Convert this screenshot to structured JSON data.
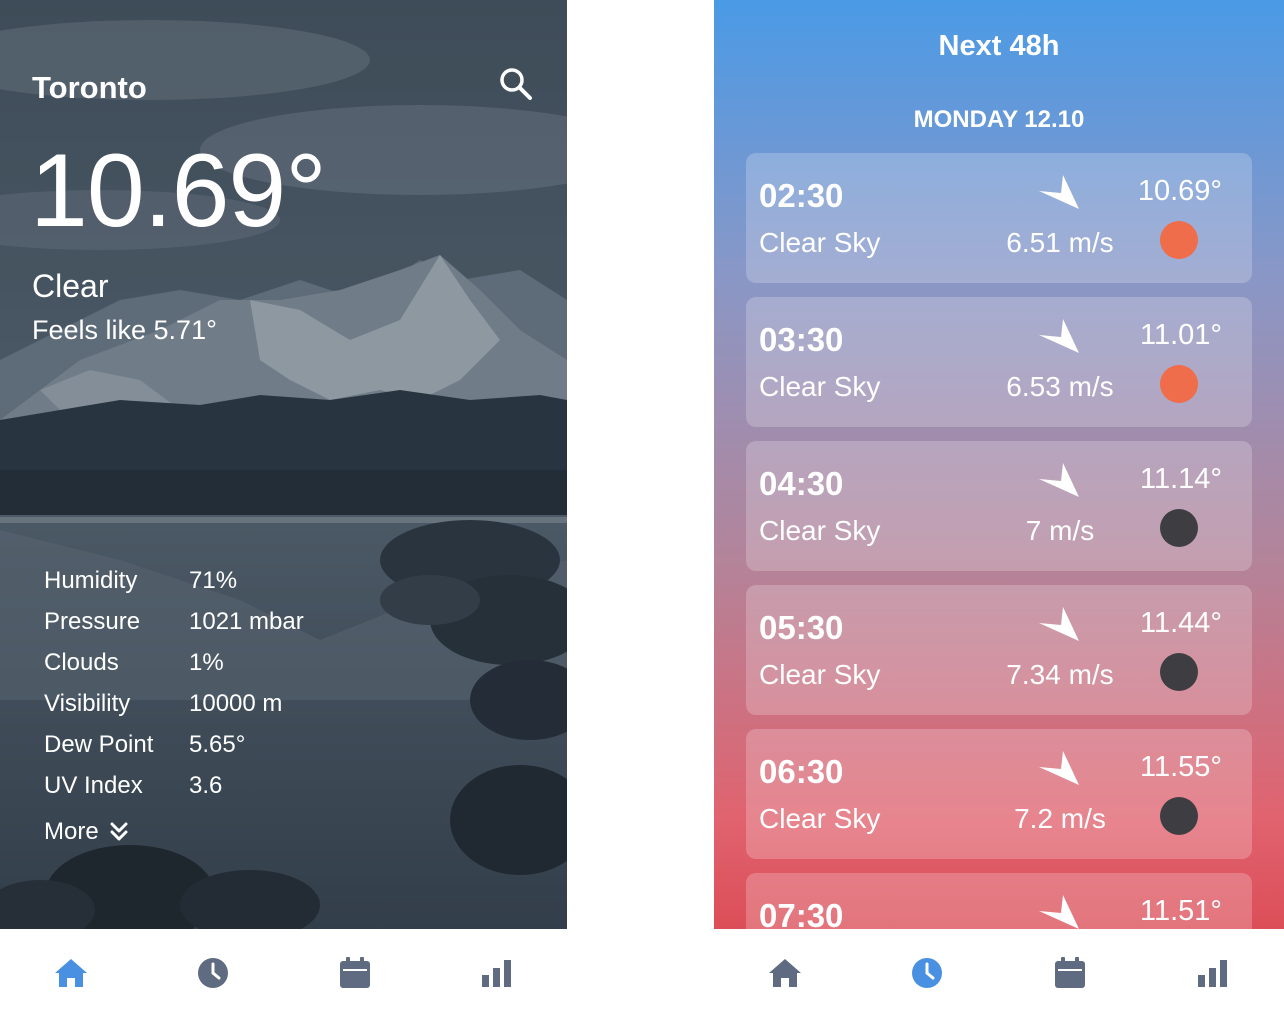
{
  "left": {
    "city": "Toronto",
    "temperature": "10.69°",
    "condition": "Clear",
    "feels_like": "Feels like 5.71°",
    "details": [
      {
        "label": "Humidity",
        "value": "71%"
      },
      {
        "label": "Pressure",
        "value": "1021 mbar"
      },
      {
        "label": "Clouds",
        "value": "1%"
      },
      {
        "label": "Visibility",
        "value": "10000 m"
      },
      {
        "label": "Dew Point",
        "value": "5.65°"
      },
      {
        "label": "UV Index",
        "value": "3.6"
      }
    ],
    "more_label": "More",
    "search_icon": "search-icon",
    "tabbar": {
      "active": 0,
      "icons": [
        "home-icon",
        "clock-icon",
        "calendar-icon",
        "bar-chart-icon"
      ]
    }
  },
  "right": {
    "title": "Next 48h",
    "day": "MONDAY 12.10",
    "hours": [
      {
        "time": "02:30",
        "desc": "Clear Sky",
        "wind": "6.51 m/s",
        "temp": "10.69°",
        "dot_color": "#ef6d4a"
      },
      {
        "time": "03:30",
        "desc": "Clear Sky",
        "wind": "6.53 m/s",
        "temp": "11.01°",
        "dot_color": "#ef6d4a"
      },
      {
        "time": "04:30",
        "desc": "Clear Sky",
        "wind": "7 m/s",
        "temp": "11.14°",
        "dot_color": "#3e3e42"
      },
      {
        "time": "05:30",
        "desc": "Clear Sky",
        "wind": "7.34 m/s",
        "temp": "11.44°",
        "dot_color": "#3e3e42"
      },
      {
        "time": "06:30",
        "desc": "Clear Sky",
        "wind": "7.2 m/s",
        "temp": "11.55°",
        "dot_color": "#3e3e42"
      },
      {
        "time": "07:30",
        "desc": "",
        "wind": "",
        "temp": "11.51°",
        "dot_color": "#3e3e42"
      }
    ],
    "tabbar": {
      "active": 1,
      "icons": [
        "home-icon",
        "clock-icon",
        "calendar-icon",
        "bar-chart-icon"
      ]
    }
  },
  "colors": {
    "accent": "#4a90e2",
    "inactive": "#5f6b80",
    "sun_dot": "#ef6d4a",
    "moon_dot": "#3e3e42"
  }
}
